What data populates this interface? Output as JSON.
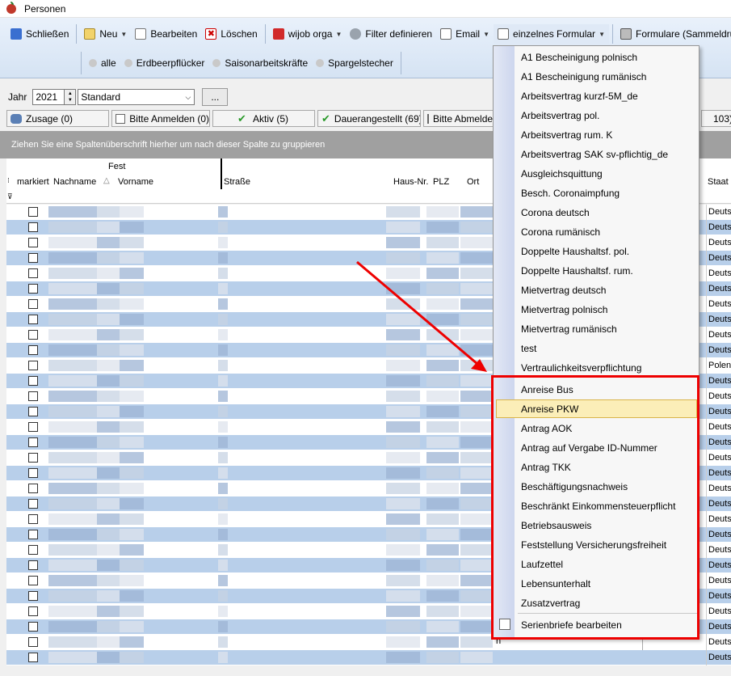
{
  "window": {
    "title": "Personen"
  },
  "toolbar": {
    "close": "Schließen",
    "new": "Neu",
    "edit": "Bearbeiten",
    "delete": "Löschen",
    "wijob": "wijob orga",
    "filter": "Filter definieren",
    "email": "Email",
    "single_form": "einzelnes Formular",
    "forms": "Formulare (Sammeldruck)"
  },
  "quickfilters": [
    "alle",
    "Erdbeerpflücker",
    "Saisonarbeitskräfte",
    "Spargelstecher"
  ],
  "year": {
    "label": "Jahr",
    "value": "2021",
    "view": "Standard",
    "more": "..."
  },
  "filters": [
    "Zusage (0)",
    "Bitte Anmelden (0)",
    "Aktiv (5)",
    "Dauerangestellt (69)",
    "Bitte Abmelden",
    "103)"
  ],
  "group_hint": "Ziehen Sie eine Spaltenüberschrift hierher um nach dieser Spalte zu gruppieren",
  "columns": {
    "marked": "markiert",
    "lastname": "Nachname",
    "fest": "Fest",
    "firstname": "Vorname",
    "street": "Straße",
    "houseno": "Haus-Nr.",
    "zip": "PLZ",
    "city": "Ort",
    "country": "Staat"
  },
  "rows_staat": [
    "Deuts",
    "Deuts",
    "Deuts",
    "Deuts",
    "Deuts",
    "Deuts",
    "Deuts",
    "Deuts",
    "Deuts",
    "Deuts",
    "Polen",
    "Deuts",
    "Deuts",
    "Deuts",
    "Deuts",
    "Deuts",
    "Deuts",
    "Deuts",
    "Deuts",
    "Deuts",
    "Deuts",
    "Deuts",
    "Deuts",
    "Deuts",
    "Deuts",
    "Deuts",
    "Deuts",
    "Deuts",
    "Deuts",
    "Deuts"
  ],
  "row_fragment": "n",
  "menu": {
    "items_top": [
      "A1 Bescheinigung polnisch",
      "A1 Bescheinigung rumänisch",
      "Arbeitsvertrag kurzf-5M_de",
      "Arbeitsvertrag pol.",
      "Arbeitsvertrag rum. K",
      "Arbeitsvertrag SAK sv-pflichtig_de",
      "Ausgleichsquittung",
      "Besch. Coronaimpfung",
      "Corona deutsch",
      "Corona rumänisch",
      "Doppelte Haushaltsf. pol.",
      "Doppelte Haushaltsf. rum.",
      "Mietvertrag deutsch",
      "Mietvertrag polnisch",
      "Mietvertrag rumänisch",
      "test",
      "Vertraulichkeitsverpflichtung"
    ],
    "items_bottom": [
      "Anreise Bus",
      "Anreise PKW",
      "Antrag AOK",
      "Antrag auf Vergabe ID-Nummer",
      "Antrag TKK",
      "Beschäftigungsnachweis",
      "Beschränkt Einkommensteuerpflicht",
      "Betriebsausweis",
      "Feststellung Versicherungsfreiheit",
      "Laufzettel",
      "Lebensunterhalt",
      "Zusatzvertrag"
    ],
    "highlighted": "Anreise PKW",
    "footer": "Serienbriefe bearbeiten"
  },
  "colors": {
    "accent": "#fbeeb8",
    "annotation": "#e00000",
    "row_alt": "#b8cfea"
  }
}
